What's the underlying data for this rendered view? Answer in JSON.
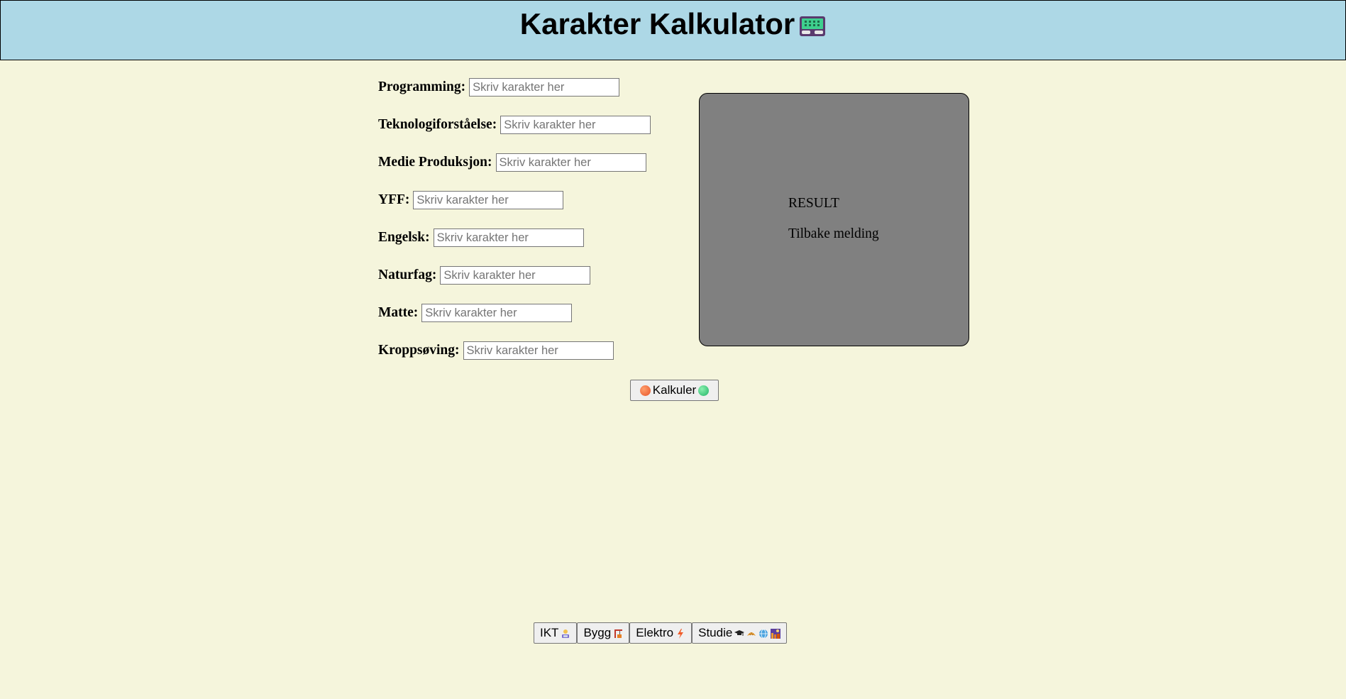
{
  "header": {
    "title": "Karakter Kalkulator",
    "title_icon": "calculator-icon"
  },
  "form": {
    "placeholder": "Skriv karakter her",
    "fields": [
      {
        "label": "Programming:",
        "value": ""
      },
      {
        "label": "Teknologiforståelse:",
        "value": ""
      },
      {
        "label": "Medie Produksjon:",
        "value": ""
      },
      {
        "label": "YFF:",
        "value": ""
      },
      {
        "label": "Engelsk:",
        "value": ""
      },
      {
        "label": "Naturfag:",
        "value": ""
      },
      {
        "label": "Matte:",
        "value": ""
      },
      {
        "label": "Kroppsøving:",
        "value": ""
      }
    ]
  },
  "result": {
    "title": "RESULT",
    "message": "Tilbake melding"
  },
  "calculate_button": {
    "label": "Kalkuler",
    "left_icon": "orange-circle-icon",
    "right_icon": "green-circle-icon"
  },
  "nav": {
    "items": [
      {
        "label": "IKT",
        "icon": "technologist-icon"
      },
      {
        "label": "Bygg",
        "icon": "construction-icon"
      },
      {
        "label": "Elektro",
        "icon": "lightning-icon"
      },
      {
        "label": "Studie",
        "icon": "graduation-icons"
      }
    ]
  },
  "colors": {
    "header_bg": "#add8e6",
    "page_bg": "#f5f5dc",
    "result_bg": "#808080"
  }
}
